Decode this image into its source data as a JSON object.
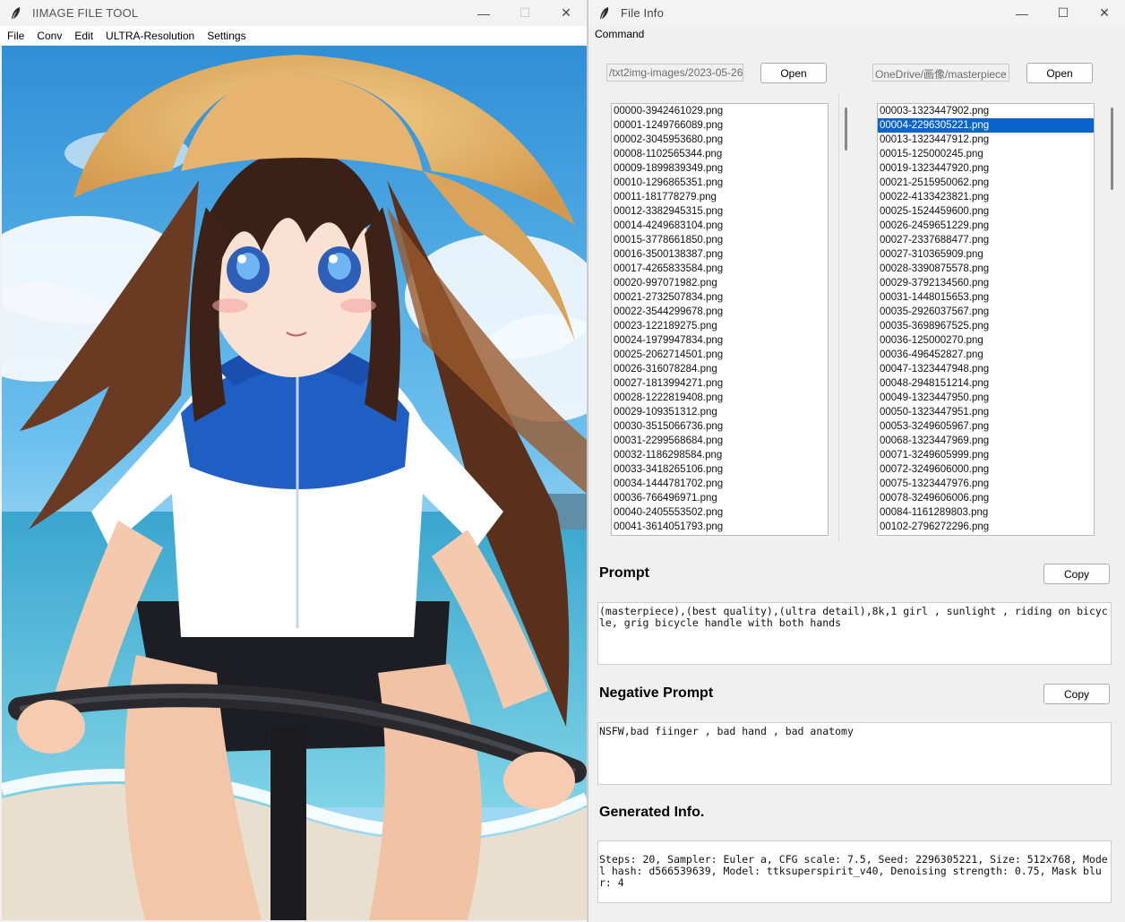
{
  "left_window": {
    "title": "IIMAGE FILE TOOL",
    "controls": {
      "minimize": "—",
      "maximize": "☐",
      "close": "✕"
    },
    "menu": [
      "File",
      "Conv",
      "Edit",
      "ULTRA-Resolution",
      "Settings"
    ]
  },
  "right_window": {
    "title": "File Info",
    "controls": {
      "minimize": "—",
      "maximize": "☐",
      "close": "✕"
    },
    "menu_command": "Command",
    "left_path": "/txt2img-images/2023-05-26",
    "right_path": "OneDrive/画像/masterpiece",
    "open_label": "Open",
    "left_files": [
      "00000-3942461029.png",
      "00001-1249766089.png",
      "00002-3045953680.png",
      "00008-1102565344.png",
      "00009-1899839349.png",
      "00010-1296865351.png",
      "00011-181778279.png",
      "00012-3382945315.png",
      "00014-4249683104.png",
      "00015-3778661850.png",
      "00016-3500138387.png",
      "00017-4265833584.png",
      "00020-997071982.png",
      "00021-2732507834.png",
      "00022-3544299678.png",
      "00023-122189275.png",
      "00024-1979947834.png",
      "00025-2062714501.png",
      "00026-316078284.png",
      "00027-1813994271.png",
      "00028-1222819408.png",
      "00029-109351312.png",
      "00030-3515066736.png",
      "00031-2299568684.png",
      "00032-1186298584.png",
      "00033-3418265106.png",
      "00034-1444781702.png",
      "00036-766496971.png",
      "00040-2405553502.png",
      "00041-3614051793.png"
    ],
    "right_files": [
      "00003-1323447902.png",
      "00004-2296305221.png",
      "00013-1323447912.png",
      "00015-125000245.png",
      "00019-1323447920.png",
      "00021-2515950062.png",
      "00022-4133423821.png",
      "00025-1524459600.png",
      "00026-2459651229.png",
      "00027-2337688477.png",
      "00027-310365909.png",
      "00028-3390875578.png",
      "00029-3792134560.png",
      "00031-1448015653.png",
      "00035-2926037567.png",
      "00035-3698967525.png",
      "00036-125000270.png",
      "00036-496452827.png",
      "00047-1323447948.png",
      "00048-2948151214.png",
      "00049-1323447950.png",
      "00050-1323447951.png",
      "00053-3249605967.png",
      "00068-1323447969.png",
      "00071-3249605999.png",
      "00072-3249606000.png",
      "00075-1323447976.png",
      "00078-3249606006.png",
      "00084-1161289803.png",
      "00102-2796272296.png"
    ],
    "selected_right_file": "00004-2296305221.png",
    "prompt_label": "Prompt",
    "prompt_text": "(masterpiece),(best quality),(ultra detail),8k,1 girl , sunlight , riding on bicycle, grig bicycle handle with both hands",
    "negative_label": "Negative Prompt",
    "negative_text": "NSFW,bad fiinger , bad hand , bad anatomy",
    "copy_label": "Copy",
    "generated_label": "Generated Info.",
    "generated_text": "Steps: 20, Sampler: Euler a, CFG scale: 7.5, Seed: 2296305221, Size: 512x768, Model hash: d566539639, Model: ttksuperspirit_v40, Denoising strength: 0.75, Mask blur: 4"
  }
}
